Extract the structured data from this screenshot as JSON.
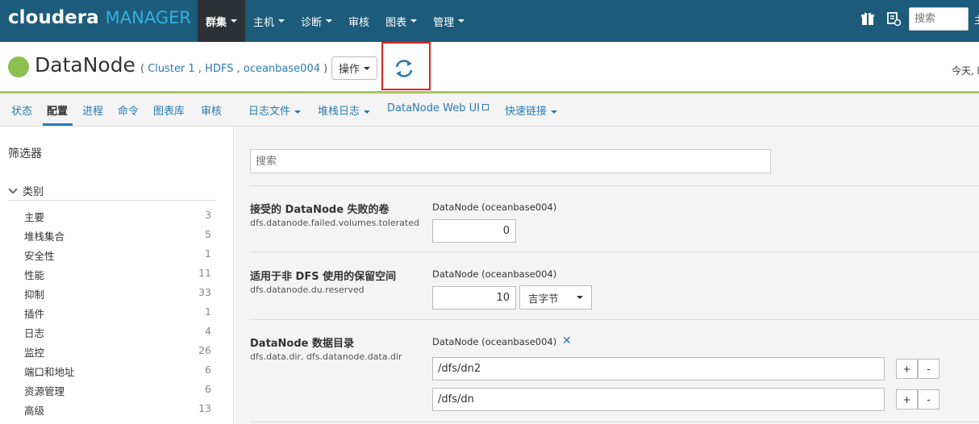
{
  "brand": {
    "part1": "cloudera",
    "part2": "MANAGER"
  },
  "topnav": {
    "items": [
      {
        "label": "群集"
      },
      {
        "label": "主机"
      },
      {
        "label": "诊断"
      },
      {
        "label": "审核"
      },
      {
        "label": "图表"
      },
      {
        "label": "管理"
      }
    ],
    "search_placeholder": "搜索",
    "extra": "主"
  },
  "header": {
    "title": "DataNode",
    "subtitle_open": "(",
    "crumbs": [
      "Cluster 1",
      "HDFS",
      "oceanbase004"
    ],
    "subtitle_close": ")",
    "actions_label": "操作",
    "today": "今天, 时"
  },
  "subnav": {
    "items": [
      "状态",
      "配置",
      "进程",
      "命令",
      "图表库",
      "审核",
      "日志文件",
      "堆栈日志",
      "DataNode Web UI",
      "快速链接"
    ]
  },
  "sidebar": {
    "filter_label": "筛选器",
    "category_label": "类别",
    "categories": [
      {
        "name": "主要",
        "count": "3"
      },
      {
        "name": "堆栈集合",
        "count": "5"
      },
      {
        "name": "安全性",
        "count": "1"
      },
      {
        "name": "性能",
        "count": "11"
      },
      {
        "name": "抑制",
        "count": "33"
      },
      {
        "name": "插件",
        "count": "1"
      },
      {
        "name": "日志",
        "count": "4"
      },
      {
        "name": "监控",
        "count": "26"
      },
      {
        "name": "端口和地址",
        "count": "6"
      },
      {
        "name": "资源管理",
        "count": "6"
      },
      {
        "name": "高级",
        "count": "13"
      }
    ]
  },
  "main": {
    "search_placeholder": "搜索",
    "props": [
      {
        "label": "接受的 DataNode 失败的卷",
        "key": "dfs.datanode.failed.volumes.tolerated",
        "scope": "DataNode (oceanbase004)",
        "value": "0"
      },
      {
        "label": "适用于非 DFS 使用的保留空间",
        "key": "dfs.datanode.du.reserved",
        "scope": "DataNode (oceanbase004)",
        "value": "10",
        "unit": "吉字节"
      },
      {
        "label": "DataNode 数据目录",
        "key": "dfs.data.dir, dfs.datanode.data.dir",
        "scope": "DataNode (oceanbase004)",
        "dirs": [
          "/dfs/dn2",
          "/dfs/dn"
        ]
      }
    ],
    "plus": "+",
    "minus": "-",
    "remove": "✕"
  }
}
